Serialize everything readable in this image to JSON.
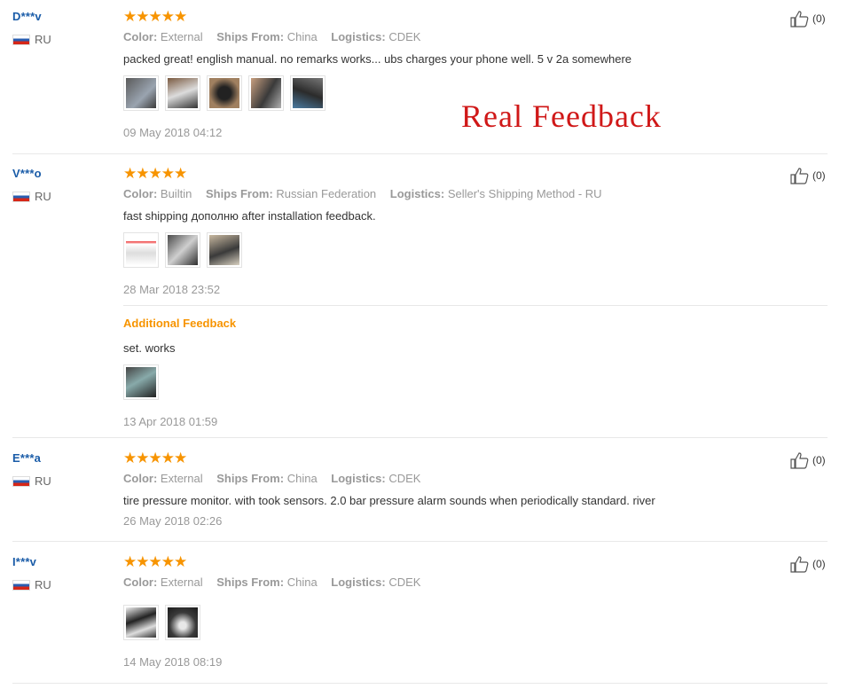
{
  "watermark": "Real Feedback",
  "reviews": [
    {
      "user": "D***v",
      "country": "RU",
      "stars": "★★★★★",
      "color_label": "Color:",
      "color": "External",
      "ships_label": "Ships From:",
      "ships": "China",
      "logistics_label": "Logistics:",
      "logistics": "CDEK",
      "text": "packed great! english manual. no remarks works... ubs charges your phone well. 5 v 2a somewhere",
      "photos": [
        "photo-1",
        "photo-2",
        "photo-3",
        "photo-4",
        "photo-5"
      ],
      "date": "09 May 2018 04:12",
      "likes": "(0)"
    },
    {
      "user": "V***o",
      "country": "RU",
      "stars": "★★★★★",
      "color_label": "Color:",
      "color": "Builtin",
      "ships_label": "Ships From:",
      "ships": "Russian Federation",
      "logistics_label": "Logistics:",
      "logistics": "Seller's Shipping Method - RU",
      "text": "fast shipping дополню after installation feedback.",
      "photos": [
        "photo-1",
        "photo-2",
        "photo-3"
      ],
      "date": "28 Mar 2018 23:52",
      "likes": "(0)",
      "additional": {
        "label": "Additional Feedback",
        "text": "set. works",
        "photos": [
          "photo-1"
        ],
        "date": "13 Apr 2018 01:59"
      }
    },
    {
      "user": "E***a",
      "country": "RU",
      "stars": "★★★★★",
      "color_label": "Color:",
      "color": "External",
      "ships_label": "Ships From:",
      "ships": "China",
      "logistics_label": "Logistics:",
      "logistics": "CDEK",
      "text": "tire pressure monitor. with took sensors. 2.0 bar pressure alarm sounds when periodically standard. river",
      "date": "26 May 2018 02:26",
      "likes": "(0)"
    },
    {
      "user": "I***v",
      "country": "RU",
      "stars": "★★★★★",
      "color_label": "Color:",
      "color": "External",
      "ships_label": "Ships From:",
      "ships": "China",
      "logistics_label": "Logistics:",
      "logistics": "CDEK",
      "photos": [
        "photo-1",
        "photo-2"
      ],
      "date": "14 May 2018 08:19",
      "likes": "(0)"
    }
  ],
  "colors": {
    "accent": "#f79400",
    "username": "#1a5ca8",
    "watermark": "#d01818"
  }
}
